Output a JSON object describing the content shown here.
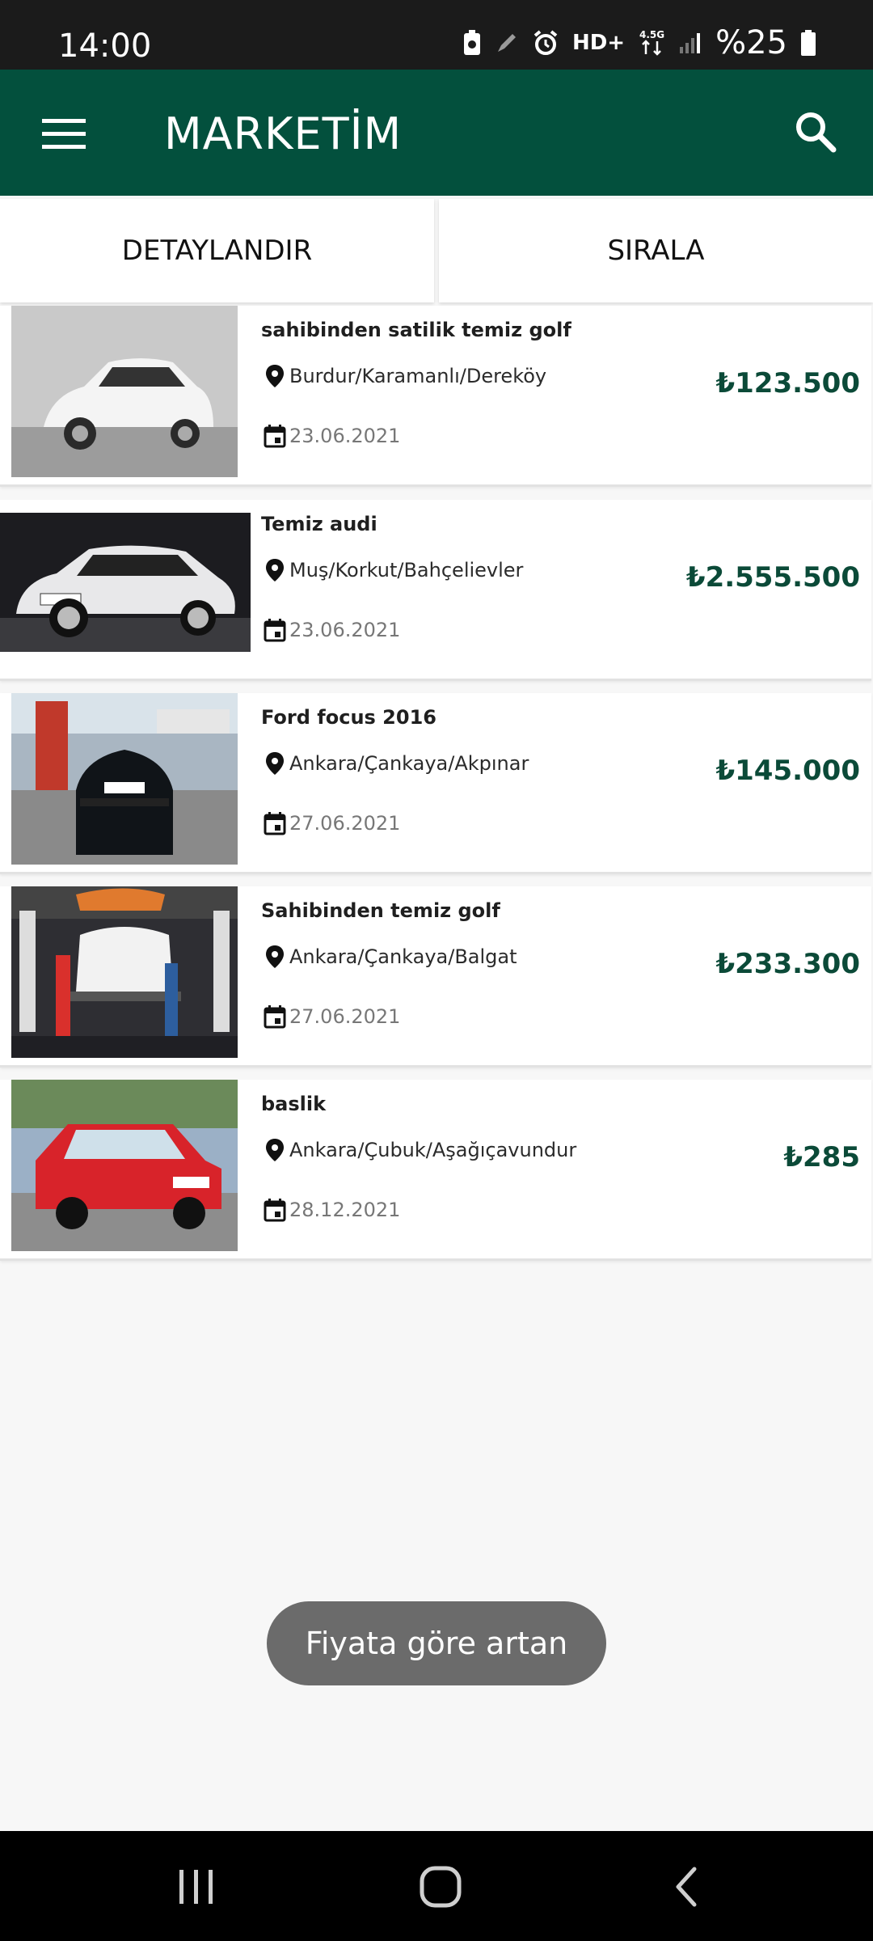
{
  "status_bar": {
    "time": "14:00",
    "network_label": "HD+",
    "battery_percent": "%25",
    "icons": [
      "battery-saver-icon",
      "pen-icon",
      "alarm-icon",
      "hd-voice-icon",
      "data-4-5g-icon",
      "signal-icon",
      "battery-icon"
    ]
  },
  "app_bar": {
    "title": "MARKETİM",
    "menu_icon": "hamburger-menu-icon",
    "search_icon": "search-icon"
  },
  "filters": {
    "detail_label": "DETAYLANDIR",
    "sort_label": "SIRALA"
  },
  "listings": [
    {
      "title": "sahibinden satilik temiz golf",
      "location": "Burdur/Karamanlı/Dereköy",
      "date": "23.06.2021",
      "price": "₺123.500"
    },
    {
      "title": "Temiz audi",
      "location": "Muş/Korkut/Bahçelievler",
      "date": "23.06.2021",
      "price": "₺2.555.500"
    },
    {
      "title": "Ford focus 2016",
      "location": "Ankara/Çankaya/Akpınar",
      "date": "27.06.2021",
      "price": "₺145.000"
    },
    {
      "title": "Sahibinden temiz golf",
      "location": "Ankara/Çankaya/Balgat",
      "date": "27.06.2021",
      "price": "₺233.300"
    },
    {
      "title": "baslik",
      "location": "Ankara/Çubuk/Aşağıçavundur",
      "date": "28.12.2021",
      "price": "₺285"
    }
  ],
  "toast": {
    "message": "Fiyata göre artan"
  },
  "nav_bar": {
    "icons": [
      "recent-apps-icon",
      "home-icon",
      "back-icon"
    ]
  },
  "colors": {
    "brand": "#03503d",
    "price": "#0b4a38",
    "toast_bg": "#6b6b6b"
  }
}
